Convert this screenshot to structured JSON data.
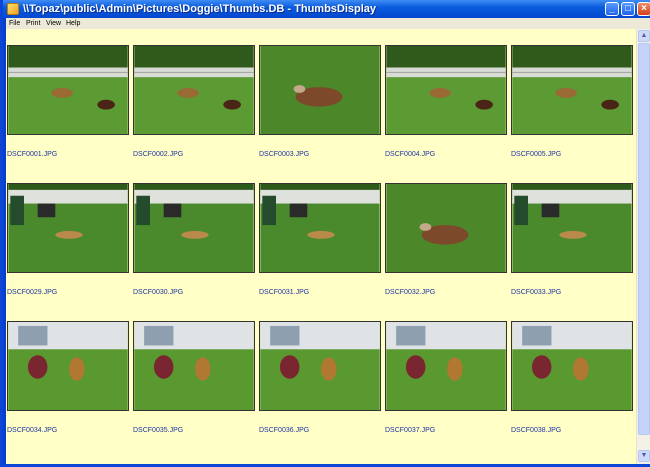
{
  "window": {
    "title": "\\\\Topaz\\public\\Admin\\Pictures\\Doggie\\Thumbs.DB - ThumbsDisplay"
  },
  "menu": [
    "File",
    "Print",
    "View",
    "Help"
  ],
  "title_buttons": {
    "minimize": "_",
    "maximize": "□",
    "close": "×"
  },
  "scrollbar": {
    "up": "▲",
    "down": "▼"
  },
  "thumbnails": [
    {
      "name": "DSCF0001.JPG",
      "scene": "fence"
    },
    {
      "name": "DSCF0002.JPG",
      "scene": "fence"
    },
    {
      "name": "DSCF0003.JPG",
      "scene": "close"
    },
    {
      "name": "DSCF0004.JPG",
      "scene": "fence"
    },
    {
      "name": "DSCF0005.JPG",
      "scene": "fence"
    },
    {
      "name": "DSCF0029.JPG",
      "scene": "patio"
    },
    {
      "name": "DSCF0030.JPG",
      "scene": "patio"
    },
    {
      "name": "DSCF0031.JPG",
      "scene": "patio"
    },
    {
      "name": "DSCF0032.JPG",
      "scene": "close"
    },
    {
      "name": "DSCF0033.JPG",
      "scene": "patio"
    },
    {
      "name": "DSCF0034.JPG",
      "scene": "house"
    },
    {
      "name": "DSCF0035.JPG",
      "scene": "house"
    },
    {
      "name": "DSCF0036.JPG",
      "scene": "house"
    },
    {
      "name": "DSCF0037.JPG",
      "scene": "house"
    },
    {
      "name": "DSCF0038.JPG",
      "scene": "house"
    }
  ]
}
